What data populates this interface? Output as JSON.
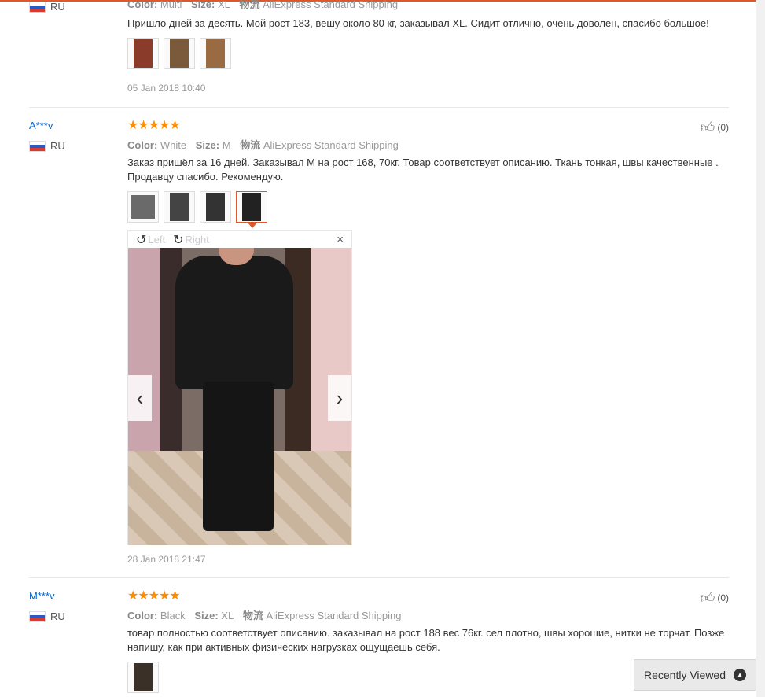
{
  "reviews": [
    {
      "user": "",
      "country": "RU",
      "color_label": "Color:",
      "color": "Multi",
      "size_label": "Size:",
      "size": "XL",
      "ship_label": "物流",
      "ship": "AliExpress Standard Shipping",
      "text": "Пришло дней за десять. Мой рост 183, вешу около 80 кг, заказывал XL. Сидит отлично, очень доволен, спасибо большое!",
      "date": "05 Jan 2018 10:40"
    },
    {
      "user": "A***v",
      "country": "RU",
      "stars": "★★★★★",
      "likes": "(0)",
      "color_label": "Color:",
      "color": "White",
      "size_label": "Size:",
      "size": "M",
      "ship_label": "物流",
      "ship": "AliExpress Standard Shipping",
      "text": "Заказ пришёл за 16 дней. Заказывал M на рост 168, 70кг. Товар соответствует описанию. Ткань тонкая, швы качественные . Продавцу спасибо. Рекомендую.",
      "date": "28 Jan 2018 21:47",
      "viewer": {
        "rotate_left": "Left",
        "rotate_right": "Right",
        "close": "×",
        "prev": "‹",
        "next": "›"
      }
    },
    {
      "user": "M***v",
      "country": "RU",
      "stars": "★★★★★",
      "likes": "(0)",
      "color_label": "Color:",
      "color": "Black",
      "size_label": "Size:",
      "size": "XL",
      "ship_label": "物流",
      "ship": "AliExpress Standard Shipping",
      "text": "товар полностью соответствует описанию. заказывал на рост 188 вес 76кг. сел плотно, швы хорошие, нитки не торчат. Позже напишу, как при активных физических нагрузках ощущаешь себя."
    }
  ],
  "recently_viewed": "Recently Viewed",
  "colors": {
    "accent": "#e0572a",
    "link": "#0066cc",
    "star": "#ff8b00"
  }
}
